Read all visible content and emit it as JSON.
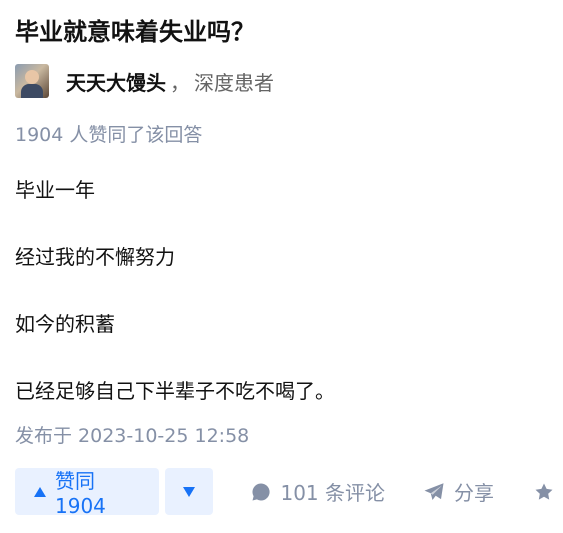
{
  "question": {
    "title": "毕业就意味着失业吗？"
  },
  "author": {
    "name": "天天大馒头",
    "separator": "，",
    "badge": "深度患者"
  },
  "vote_summary": "1904 人赞同了该回答",
  "content": {
    "paragraphs": [
      "毕业一年",
      "经过我的不懈努力",
      "如今的积蓄",
      "已经足够自己下半辈子不吃不喝了。"
    ]
  },
  "published": "发布于 2023-10-25 12:58",
  "actions": {
    "vote_up_label": "赞同 1904",
    "comment_label": "101 条评论",
    "share_label": "分享"
  },
  "colors": {
    "accent": "#1772f6",
    "accent_bg": "#e9f1ff",
    "meta": "#8590a6"
  },
  "icons": {
    "comment": "comment-icon",
    "share": "share-icon",
    "favorite": "star-icon"
  }
}
